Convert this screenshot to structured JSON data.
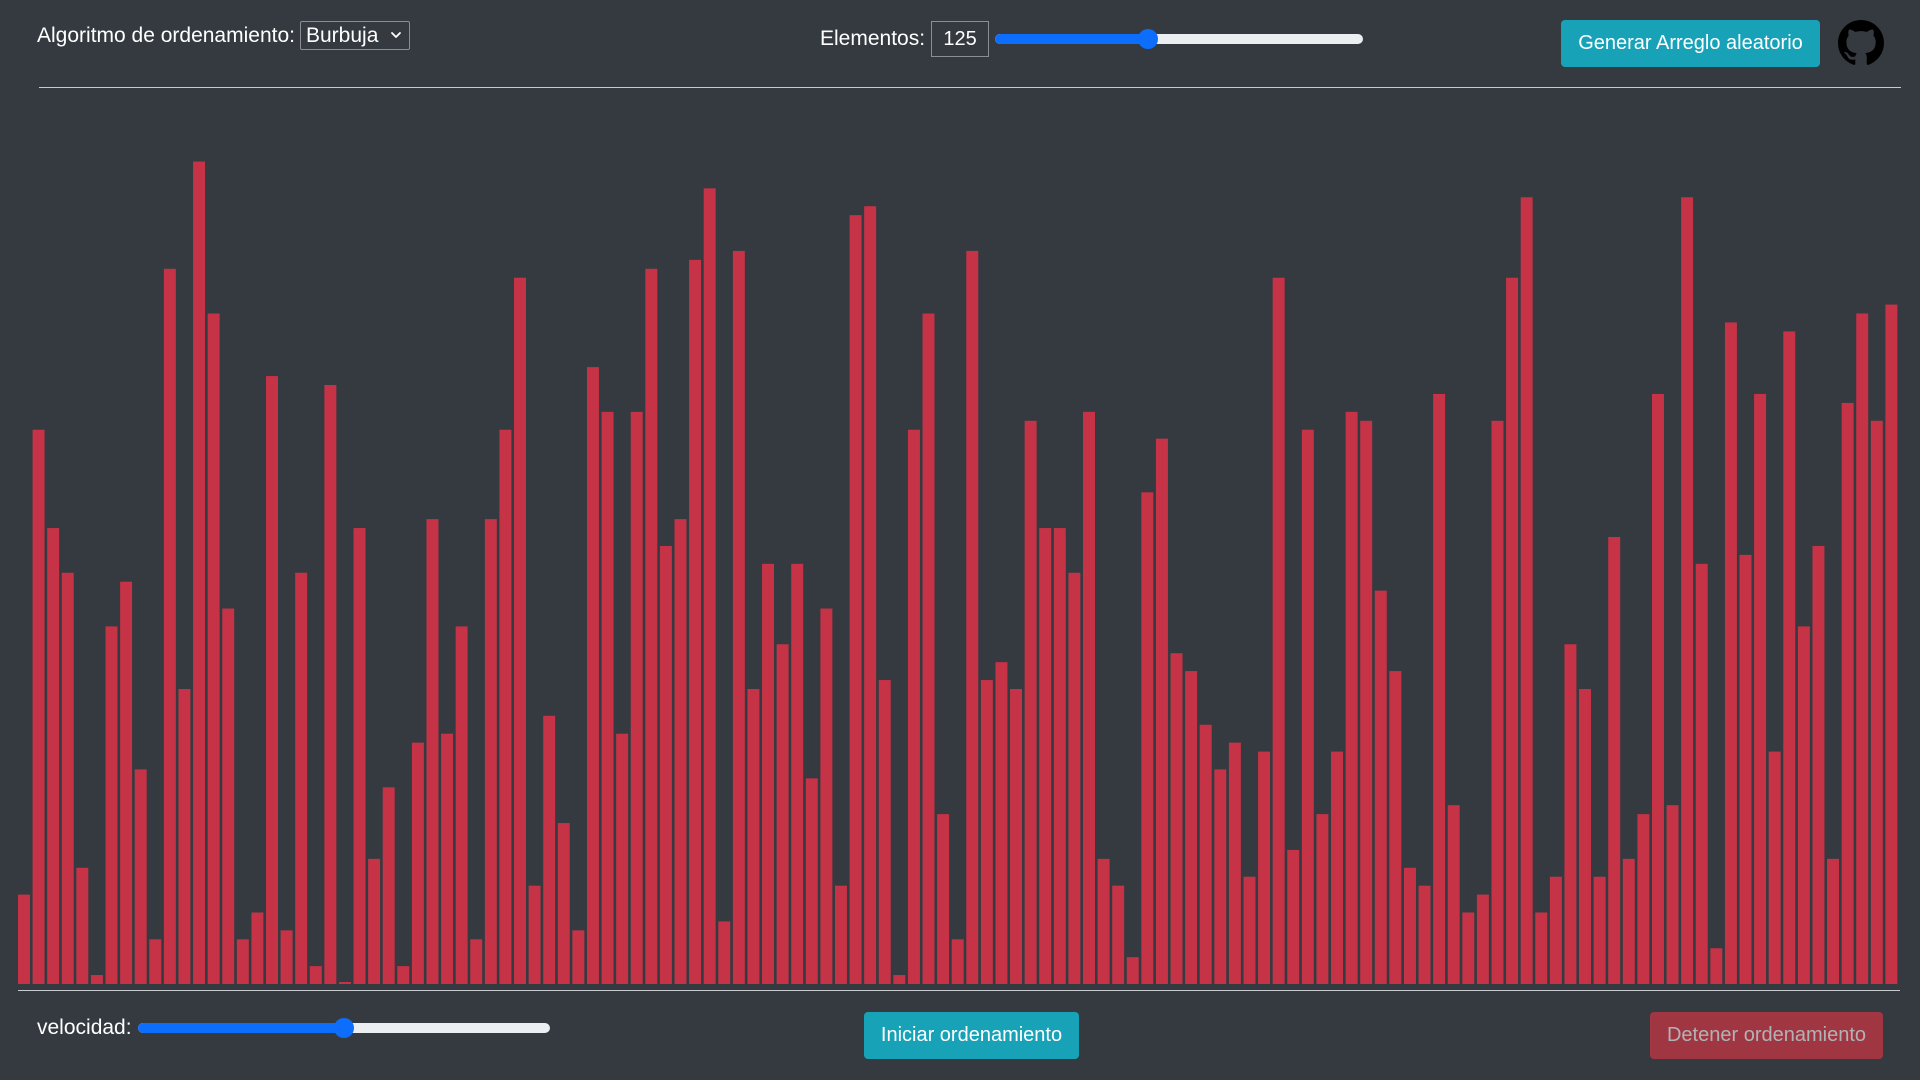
{
  "topbar": {
    "algorithm_label": "Algoritmo de ordenamiento:",
    "algorithm_selected": "Burbuja",
    "elements_label": "Elementos:",
    "elements_value": "125",
    "elements_slider_fraction": 0.41,
    "generate_button": "Generar Arreglo aleatorio",
    "github_icon": "github-icon"
  },
  "bottombar": {
    "speed_label": "velocidad:",
    "speed_slider_fraction": 0.5,
    "start_button": "Iniciar ordenamiento",
    "stop_button": "Detener ordenamiento"
  },
  "colors": {
    "background": "#343a40",
    "bar": "#c63347",
    "info_button": "#17a2b8",
    "danger_button": "#dc3545",
    "slider_accent": "#0d6efd"
  },
  "chart_data": {
    "type": "bar",
    "count": 125,
    "ylim": [
      0,
      100
    ],
    "values": [
      10,
      62,
      51,
      46,
      13,
      1,
      40,
      45,
      24,
      5,
      80,
      33,
      92,
      75,
      42,
      5,
      8,
      68,
      6,
      46,
      2,
      67,
      0,
      51,
      14,
      22,
      2,
      27,
      52,
      28,
      40,
      5,
      52,
      62,
      79,
      11,
      30,
      18,
      6,
      69,
      64,
      28,
      64,
      80,
      49,
      52,
      81,
      89,
      7,
      82,
      33,
      47,
      38,
      47,
      23,
      42,
      11,
      86,
      87,
      34,
      1,
      62,
      75,
      19,
      5,
      82,
      34,
      36,
      33,
      63,
      51,
      51,
      46,
      64,
      14,
      11,
      3,
      55,
      61,
      37,
      35,
      29,
      24,
      27,
      12,
      26,
      79,
      15,
      62,
      19,
      26,
      64,
      63,
      44,
      35,
      13,
      11,
      66,
      20,
      8,
      10,
      63,
      79,
      88,
      8,
      12,
      38,
      33,
      12,
      50,
      14,
      19,
      66,
      20,
      88,
      47,
      4,
      74,
      48,
      66,
      26,
      73,
      40,
      49,
      14,
      65,
      75,
      63,
      76
    ]
  }
}
